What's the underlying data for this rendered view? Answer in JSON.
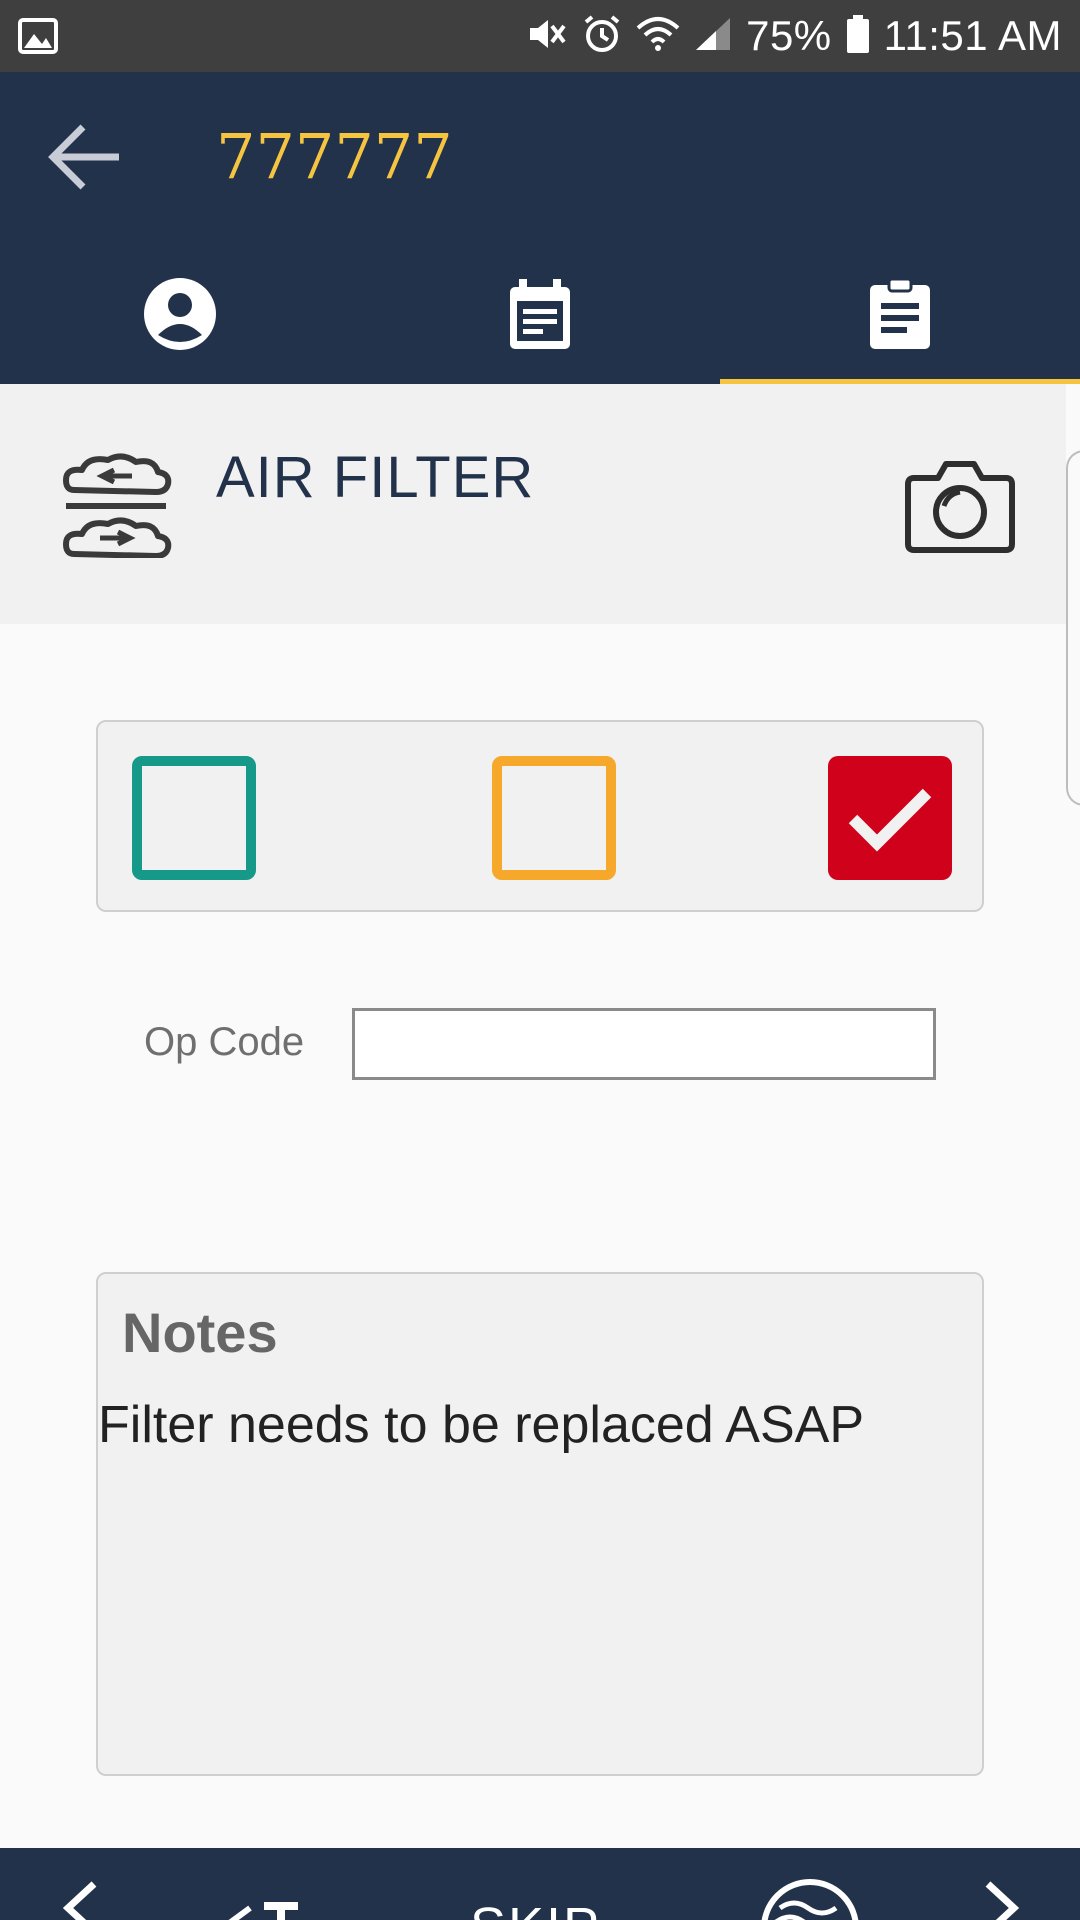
{
  "status_bar": {
    "battery": "75%",
    "time": "11:51 AM"
  },
  "header": {
    "title": "777777",
    "tabs": [
      {
        "icon": "account-circle-icon",
        "active": false
      },
      {
        "icon": "calendar-note-icon",
        "active": false
      },
      {
        "icon": "clipboard-icon",
        "active": true
      }
    ]
  },
  "section": {
    "title": "AIR FILTER",
    "icon": "air-filter-icon"
  },
  "status_choices": [
    {
      "color": "#17998a",
      "checked": false
    },
    {
      "color": "#f5a82a",
      "checked": false
    },
    {
      "color": "#d0021b",
      "checked": true
    }
  ],
  "op_code": {
    "label": "Op Code",
    "value": ""
  },
  "notes": {
    "label": "Notes",
    "text": "Filter needs to be replaced ASAP"
  },
  "bottom_nav": {
    "skip_label": "SKIP"
  },
  "colors": {
    "header_bg": "#23324b",
    "accent": "#f5c542"
  }
}
